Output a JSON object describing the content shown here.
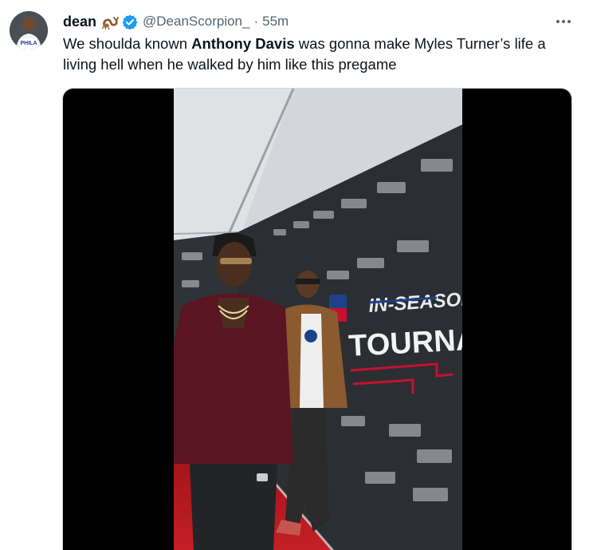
{
  "tweet": {
    "display_name": "dean",
    "handle": "@DeanScorpion_",
    "separator": "·",
    "time": "55m",
    "text_before": "We shoulda known ",
    "text_bold": "Anthony Davis",
    "text_after": " was gonna make Myles Turner’s life a living hell when he walked by him like this pregame",
    "avatar_jersey_text": "PHILA"
  },
  "video": {
    "backdrop_title_line1": "IN-SEASON",
    "backdrop_title_line2": "TOURNAMENT",
    "logo_repeat_text": "TOURNAMENT"
  },
  "colors": {
    "text_primary": "#0f1419",
    "text_secondary": "#536471",
    "verified": "#1d9bf0",
    "red_carpet": "#b4161e",
    "backdrop": "#2b2f33"
  }
}
